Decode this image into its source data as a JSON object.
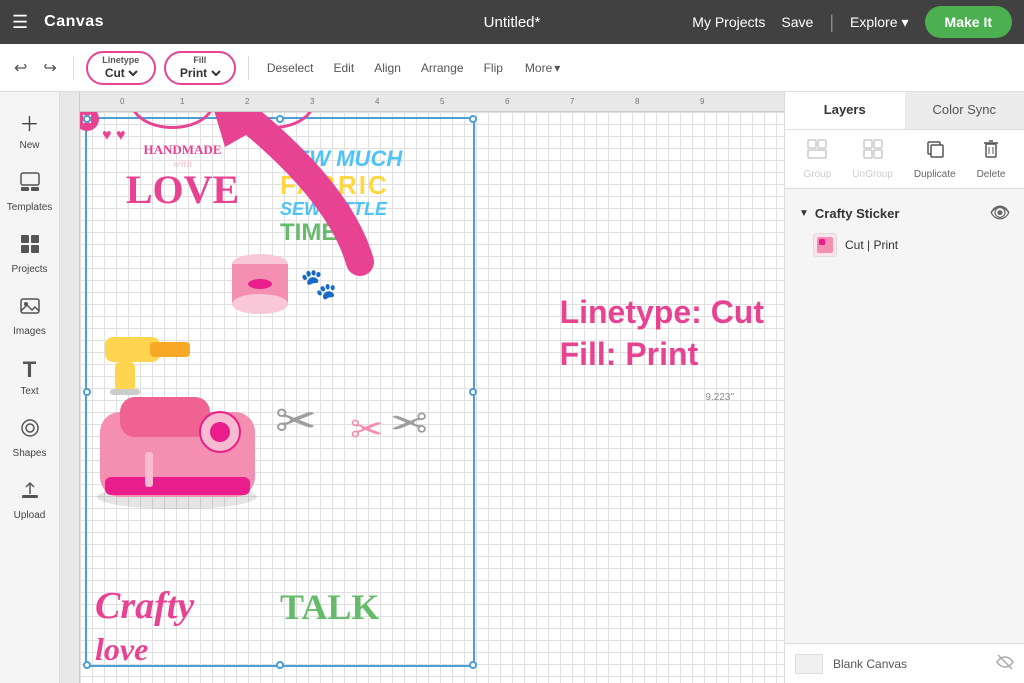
{
  "topbar": {
    "menu_icon": "☰",
    "logo": "Canvas",
    "title": "Untitled*",
    "my_projects": "My Projects",
    "save": "Save",
    "divider": "|",
    "explore": "Explore",
    "explore_chevron": "▾",
    "make_btn": "Make It"
  },
  "toolbar": {
    "undo_icon": "↩",
    "redo_icon": "↪",
    "linetype_label": "Linetype",
    "linetype_value": "Cut",
    "fill_label": "Fill",
    "fill_value": "Print",
    "deselect_btn": "Deselect",
    "edit_btn": "Edit",
    "align_btn": "Align",
    "arrange_btn": "Arrange",
    "flip_btn": "Flip",
    "more_btn": "More",
    "more_chevron": "▾"
  },
  "left_sidebar": {
    "items": [
      {
        "id": "new",
        "icon": "+",
        "label": "New"
      },
      {
        "id": "templates",
        "icon": "👕",
        "label": "Templates"
      },
      {
        "id": "projects",
        "icon": "⊞",
        "label": "Projects"
      },
      {
        "id": "images",
        "icon": "🖼",
        "label": "Images"
      },
      {
        "id": "text",
        "icon": "T",
        "label": "Text"
      },
      {
        "id": "shapes",
        "icon": "◎",
        "label": "Shapes"
      },
      {
        "id": "upload",
        "icon": "⬆",
        "label": "Upload"
      }
    ]
  },
  "canvas": {
    "ruler_labels": [
      "0",
      "1",
      "2",
      "3",
      "4",
      "5",
      "6",
      "7",
      "8",
      "9"
    ],
    "measure_label": "9.223\""
  },
  "annotation": {
    "arrow_color": "#e84393",
    "text_line1": "Linetype: Cut",
    "text_line2": "Fill: Print"
  },
  "right_panel": {
    "tabs": [
      {
        "id": "layers",
        "label": "Layers"
      },
      {
        "id": "color_sync",
        "label": "Color Sync"
      }
    ],
    "active_tab": "layers",
    "actions": [
      {
        "id": "group",
        "icon": "⊞",
        "label": "Group",
        "disabled": true
      },
      {
        "id": "ungroup",
        "icon": "⊟",
        "label": "UnGroup",
        "disabled": true
      },
      {
        "id": "duplicate",
        "icon": "⧉",
        "label": "Duplicate",
        "disabled": false
      },
      {
        "id": "delete",
        "icon": "🗑",
        "label": "Delete",
        "disabled": false
      }
    ],
    "group": {
      "name": "Crafty Sticker",
      "visible": true,
      "item": {
        "thumb_color": "#f48fb1",
        "label": "Cut  |  Print"
      }
    },
    "bottom": {
      "label": "Blank Canvas",
      "visible": false
    }
  }
}
